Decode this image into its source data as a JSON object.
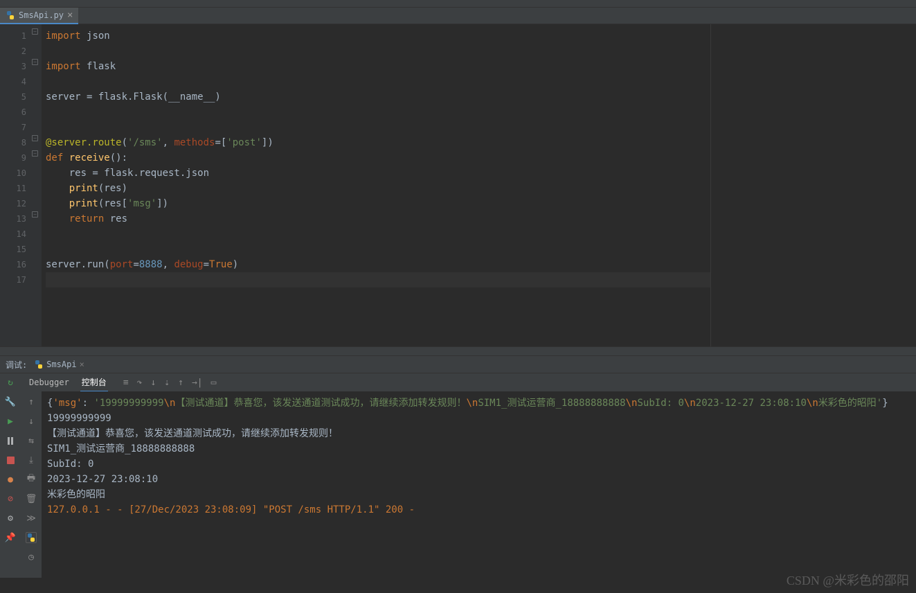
{
  "tab": {
    "filename": "SmsApi.py"
  },
  "editor": {
    "lines": [
      "1",
      "2",
      "3",
      "4",
      "5",
      "6",
      "7",
      "8",
      "9",
      "10",
      "11",
      "12",
      "13",
      "14",
      "15",
      "16",
      "17"
    ],
    "code": {
      "l1a": "import ",
      "l1b": "json",
      "l3a": "import ",
      "l3b": "flask",
      "l5": "server = flask.Flask(__name__)",
      "l8a": "@server.route",
      "l8b": "(",
      "l8c": "'/sms'",
      "l8d": ", ",
      "l8e": "methods",
      "l8f": "=[",
      "l8g": "'post'",
      "l8h": "])",
      "l9a": "def ",
      "l9b": "receive",
      "l9c": "():",
      "l10": "    res = flask.request.json",
      "l11a": "    ",
      "l11b": "print",
      "l11c": "(res)",
      "l12a": "    ",
      "l12b": "print",
      "l12c": "(res[",
      "l12d": "'msg'",
      "l12e": "])",
      "l13a": "    ",
      "l13b": "return ",
      "l13c": "res",
      "l16a": "server.run(",
      "l16b": "port",
      "l16c": "=",
      "l16d": "8888",
      "l16e": ", ",
      "l16f": "debug",
      "l16g": "=",
      "l16h": "True",
      "l16i": ")"
    }
  },
  "debug": {
    "label": "调试:",
    "active": "SmsApi",
    "tabs": {
      "debugger": "Debugger",
      "console": "控制台"
    }
  },
  "console": {
    "l1a": "{",
    "l1b": "'msg'",
    "l1c": ": ",
    "l1d": "'19999999999",
    "l1e": "\\n",
    "l1f": "【测试通道】恭喜您，该发送通道测试成功，请继续添加转发规则！",
    "l1g": "\\n",
    "l1h": "SIM1_测试运营商_18888888888",
    "l1i": "\\n",
    "l1j": "SubId: 0",
    "l1k": "\\n",
    "l1l": "2023-12-27 23:08:10",
    "l1m": "\\n",
    "l1n": "米彩色的昭阳'",
    "l1o": "}",
    "l2": "19999999999",
    "l3": "【测试通道】恭喜您，该发送通道测试成功，请继续添加转发规则！",
    "l4": "SIM1_测试运营商_18888888888",
    "l5": "SubId: 0",
    "l6": "2023-12-27 23:08:10",
    "l7": "米彩色的昭阳",
    "l8": "127.0.0.1 - - [27/Dec/2023 23:08:09] \"POST /sms HTTP/1.1\" 200 -"
  },
  "watermark": "CSDN @米彩色的邵阳"
}
